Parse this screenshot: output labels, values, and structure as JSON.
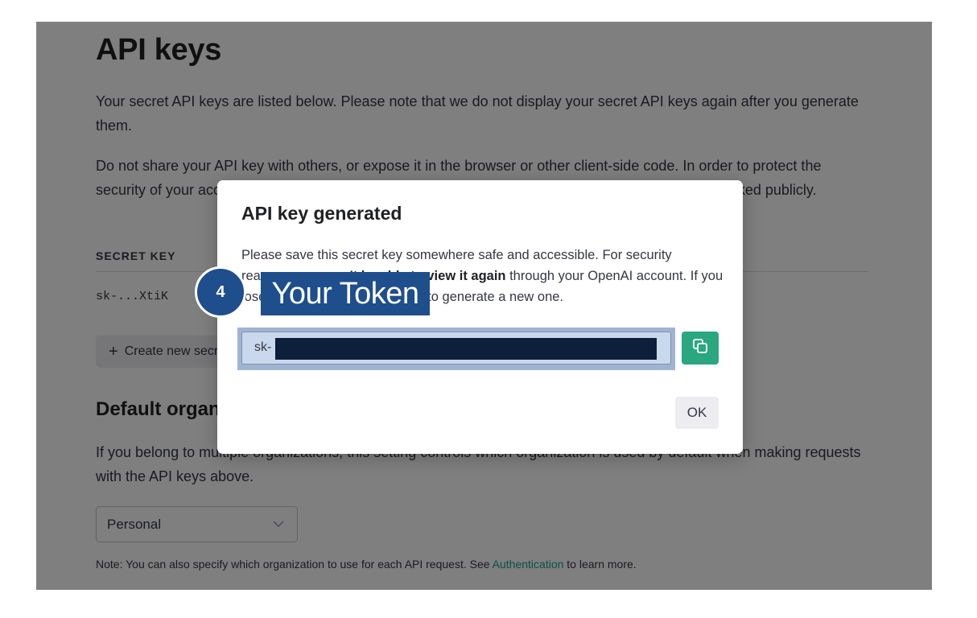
{
  "page": {
    "title": "API keys",
    "intro_1": "Your secret API keys are listed below. Please note that we do not display your secret API keys again after you generate them.",
    "intro_2": "Do not share your API key with others, or expose it in the browser or other client-side code. In order to protect the security of your account, OpenAI may also automatically rotate any API key that we've found has leaked publicly.",
    "secret_key_header": "SECRET KEY",
    "existing_key": "sk-...XtiK",
    "create_button": "Create new secret key",
    "default_org_title": "Default organization",
    "default_org_text": "If you belong to multiple organizations, this setting controls which organization is used by default when making requests with the API keys above.",
    "org_select_value": "Personal",
    "note_prefix": "Note: You can also specify which organization to use for each API request. See ",
    "note_link": "Authentication",
    "note_suffix": " to learn more."
  },
  "modal": {
    "title": "API key generated",
    "text_1": "Please save this secret key somewhere safe and accessible. For security reasons, ",
    "text_bold": "you won't be able to view it again",
    "text_2": " through your OpenAI account. If you lose this secret key, you'll need to generate a new one.",
    "key_prefix": "sk-",
    "ok_button": "OK"
  },
  "annotation": {
    "step_number": "4",
    "label": "Your Token",
    "color": "#1f4e8c"
  },
  "icons": {
    "copy": "copy-icon",
    "plus": "plus-icon",
    "chevron": "chevron-down-icon"
  },
  "colors": {
    "accent_green": "#10a37f",
    "copy_button": "#2aa77f",
    "redaction": "#0d1f3a"
  }
}
